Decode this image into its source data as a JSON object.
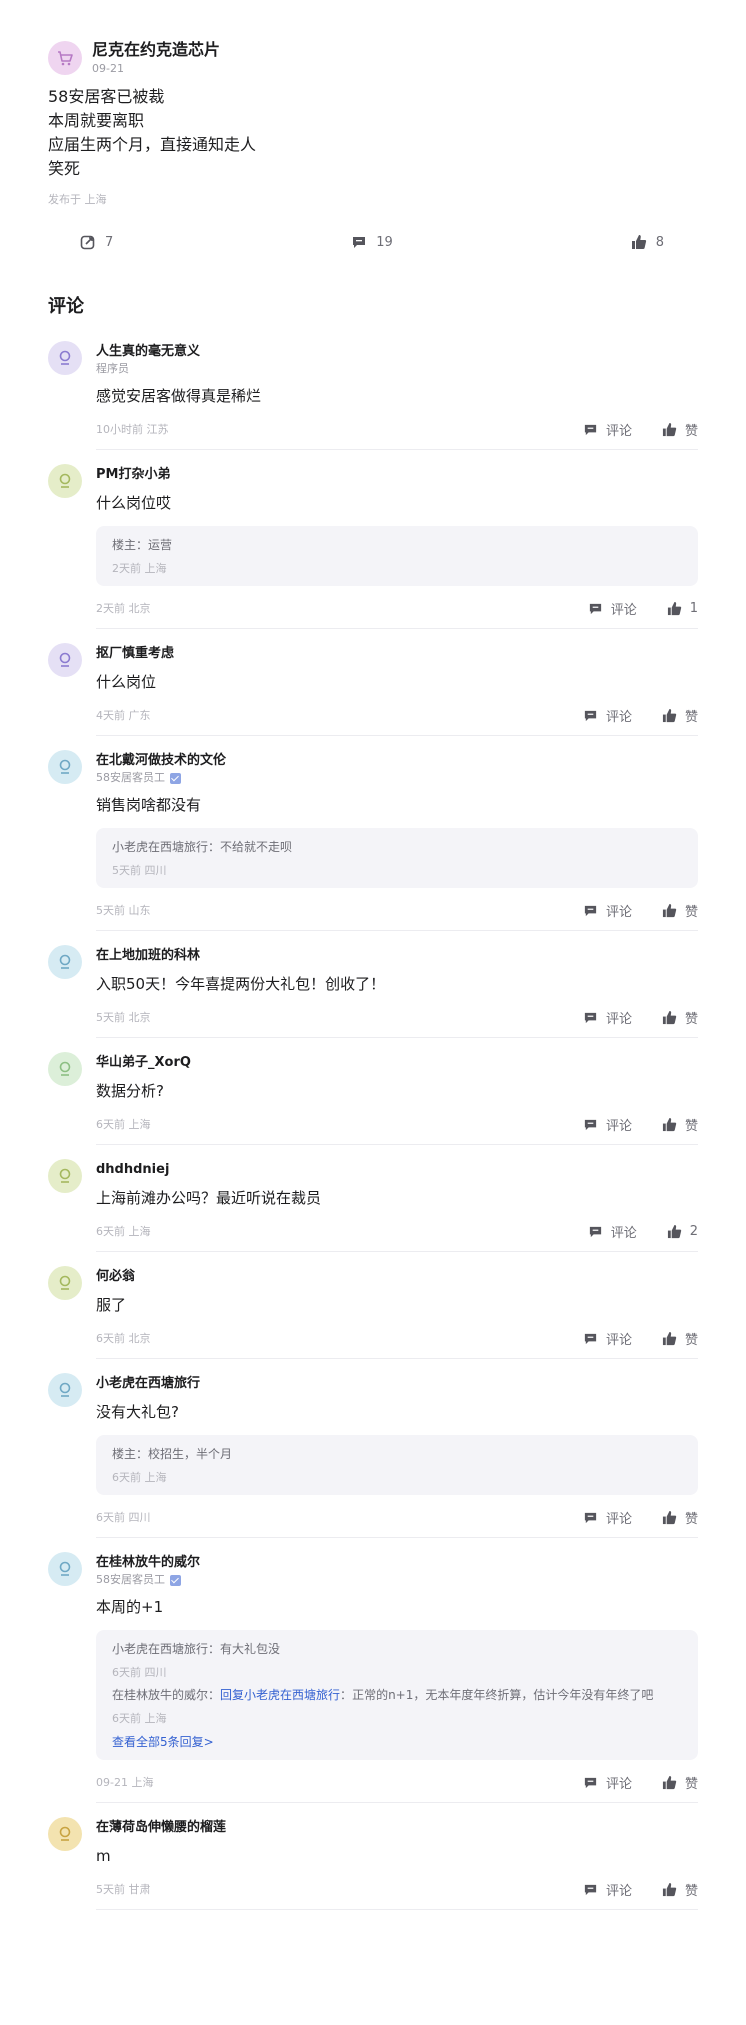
{
  "post": {
    "author": "尼克在约克造芯片",
    "date": "09-21",
    "avatar_icon": "cart-icon",
    "avatar_bg": "#efd5f0",
    "lines": [
      "58安居客已被裁",
      "本周就要离职",
      "应届生两个月，直接通知走人",
      "笑死"
    ],
    "location": "发布于 上海",
    "stats": {
      "forward": "7",
      "comments": "19",
      "likes": "8"
    }
  },
  "section_title": "评论",
  "labels": {
    "comment": "评论"
  },
  "comments": [
    {
      "name": "人生真的毫无意义",
      "title": "程序员",
      "verified": false,
      "avatar_bg": "#e5e0f5",
      "avatar_fg": "#8b7bd0",
      "text": "感觉安居客做得真是稀烂",
      "replies": [],
      "more": "",
      "meta": "10小时前 江苏",
      "likes": "赞"
    },
    {
      "name": "PM打杂小弟",
      "title": "",
      "verified": false,
      "avatar_bg": "#e5edc9",
      "avatar_fg": "#a4b85e",
      "text": "什么岗位哎",
      "replies": [
        {
          "author": "楼主",
          "reply_to": "",
          "content": "运营",
          "meta": "2天前 上海"
        }
      ],
      "more": "",
      "meta": "2天前 北京",
      "likes": "1"
    },
    {
      "name": "抠厂慎重考虑",
      "title": "",
      "verified": false,
      "avatar_bg": "#e5e0f5",
      "avatar_fg": "#8b7bd0",
      "text": "什么岗位",
      "replies": [],
      "more": "",
      "meta": "4天前 广东",
      "likes": "赞"
    },
    {
      "name": "在北戴河做技术的文伦",
      "title": "58安居客员工",
      "verified": true,
      "avatar_bg": "#d6ebf3",
      "avatar_fg": "#6fa8c4",
      "text": "销售岗啥都没有",
      "replies": [
        {
          "author": "小老虎在西塘旅行",
          "reply_to": "",
          "content": "不给就不走呗",
          "meta": "5天前 四川"
        }
      ],
      "more": "",
      "meta": "5天前 山东",
      "likes": "赞"
    },
    {
      "name": "在上地加班的科林",
      "title": "",
      "verified": false,
      "avatar_bg": "#d6ebf3",
      "avatar_fg": "#6fa8c4",
      "text": "入职50天！今年喜提两份大礼包！创收了！",
      "replies": [],
      "more": "",
      "meta": "5天前 北京",
      "likes": "赞"
    },
    {
      "name": "华山弟子_XorQ",
      "title": "",
      "verified": false,
      "avatar_bg": "#dcefd9",
      "avatar_fg": "#8cbf83",
      "text": "数据分析?",
      "replies": [],
      "more": "",
      "meta": "6天前 上海",
      "likes": "赞"
    },
    {
      "name": "dhdhdniej",
      "title": "",
      "verified": false,
      "avatar_bg": "#e5edc9",
      "avatar_fg": "#a4b85e",
      "text": "上海前滩办公吗？最近听说在裁员",
      "replies": [],
      "more": "",
      "meta": "6天前 上海",
      "likes": "2"
    },
    {
      "name": "何必翁",
      "title": "",
      "verified": false,
      "avatar_bg": "#e5edc9",
      "avatar_fg": "#a4b85e",
      "text": "服了",
      "replies": [],
      "more": "",
      "meta": "6天前 北京",
      "likes": "赞"
    },
    {
      "name": "小老虎在西塘旅行",
      "title": "",
      "verified": false,
      "avatar_bg": "#d6ebf3",
      "avatar_fg": "#6fa8c4",
      "text": "没有大礼包?",
      "replies": [
        {
          "author": "楼主",
          "reply_to": "",
          "content": "校招生，半个月",
          "meta": "6天前 上海"
        }
      ],
      "more": "",
      "meta": "6天前 四川",
      "likes": "赞"
    },
    {
      "name": "在桂林放牛的威尔",
      "title": "58安居客员工",
      "verified": true,
      "avatar_bg": "#d6ebf3",
      "avatar_fg": "#6fa8c4",
      "text": "本周的+1",
      "replies": [
        {
          "author": "小老虎在西塘旅行",
          "reply_to": "",
          "content": "有大礼包没",
          "meta": "6天前 四川"
        },
        {
          "author": "在桂林放牛的威尔",
          "reply_to": "回复小老虎在西塘旅行",
          "content": "正常的n+1，无本年度年终折算，估计今年没有年终了吧",
          "meta": "6天前 上海"
        }
      ],
      "more": "查看全部5条回复>",
      "meta": "09-21 上海",
      "likes": "赞"
    },
    {
      "name": "在薄荷岛伸懒腰的榴莲",
      "title": "",
      "verified": false,
      "avatar_bg": "#f3e3b0",
      "avatar_fg": "#c8a341",
      "text": "m",
      "replies": [],
      "more": "",
      "meta": "5天前 甘肃",
      "likes": "赞"
    }
  ]
}
